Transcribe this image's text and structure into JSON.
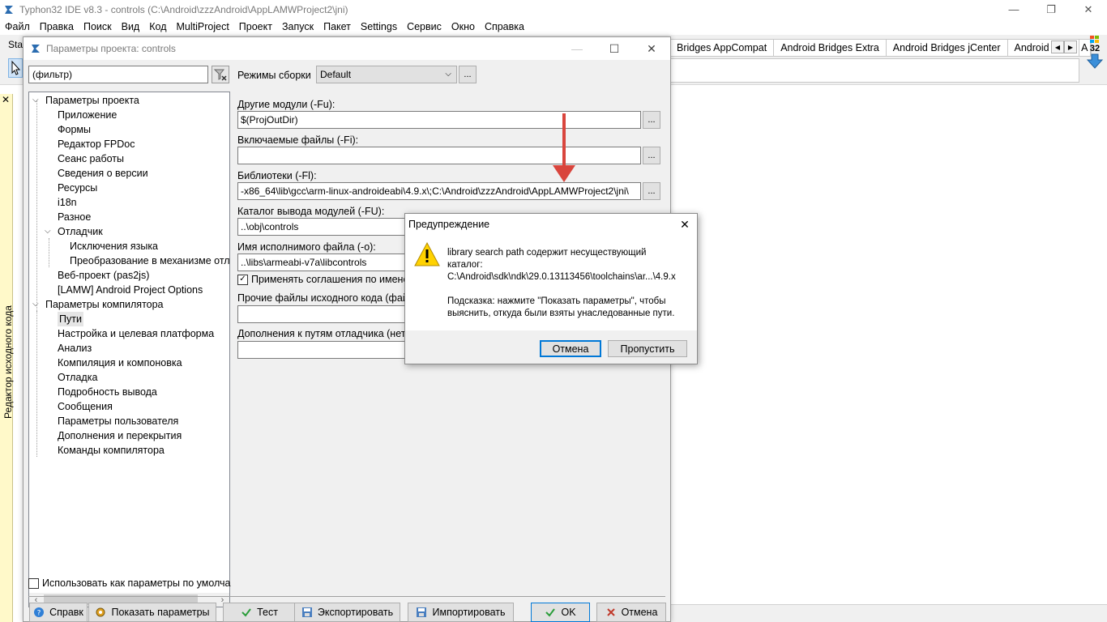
{
  "window": {
    "title": "Typhon32 IDE v8.3 - controls (C:\\Android\\zzzAndroid\\AppLAMWProject2\\jni)",
    "controls": {
      "minimize": "—",
      "restore": "❐",
      "close": "✕"
    }
  },
  "menu": [
    "Файл",
    "Правка",
    "Поиск",
    "Вид",
    "Код",
    "MultiProject",
    "Проект",
    "Запуск",
    "Пакет",
    "Settings",
    "Сервис",
    "Окно",
    "Справка"
  ],
  "toolbar": {
    "left_stub": "Sta",
    "tabs": [
      "Bridges AppCompat",
      "Android Bridges Extra",
      "Android Bridges jCenter",
      "Android FPC",
      "A"
    ],
    "bitness": "32"
  },
  "side_editor": {
    "label": "Редактор исходного кода",
    "close": "✕"
  },
  "dialog": {
    "title": "Параметры проекта: controls",
    "controls": {
      "minimize": "—",
      "maximize": "☐",
      "close": "✕"
    },
    "filter_placeholder": "(фильтр)",
    "tree": [
      {
        "label": "Параметры проекта",
        "level": 0,
        "expanded": true
      },
      {
        "label": "Приложение",
        "level": 1
      },
      {
        "label": "Формы",
        "level": 1
      },
      {
        "label": "Редактор FPDoc",
        "level": 1
      },
      {
        "label": "Сеанс работы",
        "level": 1
      },
      {
        "label": "Сведения о версии",
        "level": 1
      },
      {
        "label": "Ресурсы",
        "level": 1
      },
      {
        "label": "i18n",
        "level": 1
      },
      {
        "label": "Разное",
        "level": 1
      },
      {
        "label": "Отладчик",
        "level": 1,
        "expanded": true
      },
      {
        "label": "Исключения языка",
        "level": 2
      },
      {
        "label": "Преобразование в механизме отлад",
        "level": 2
      },
      {
        "label": "Веб-проект (pas2js)",
        "level": 1
      },
      {
        "label": "[LAMW] Android Project Options",
        "level": 1
      },
      {
        "label": "Параметры компилятора",
        "level": 0,
        "expanded": true
      },
      {
        "label": "Пути",
        "level": 1,
        "selected": true
      },
      {
        "label": "Настройка и целевая платформа",
        "level": 1
      },
      {
        "label": "Анализ",
        "level": 1
      },
      {
        "label": "Компиляция и компоновка",
        "level": 1
      },
      {
        "label": "Отладка",
        "level": 1
      },
      {
        "label": "Подробность вывода",
        "level": 1
      },
      {
        "label": "Сообщения",
        "level": 1
      },
      {
        "label": "Параметры пользователя",
        "level": 1
      },
      {
        "label": "Дополнения и перекрытия",
        "level": 1
      },
      {
        "label": "Команды компилятора",
        "level": 1
      }
    ],
    "use_default_label": "Использовать как параметры по умолча",
    "build_modes_label": "Режимы сборки",
    "build_mode_value": "Default",
    "fields": {
      "other_units_label": "Другие модули (-Fu):",
      "other_units_value": "$(ProjOutDir)",
      "include_label": "Включаемые файлы (-Fi):",
      "include_value": "",
      "libs_label": "Библиотеки (-Fl):",
      "libs_value": "-x86_64\\lib\\gcc\\arm-linux-androideabi\\4.9.x\\;C:\\Android\\zzzAndroid\\AppLAMWProject2\\jni\\",
      "unit_out_label": "Каталог вывода модулей (-FU):",
      "unit_out_value": "..\\obj\\controls",
      "exe_label": "Имя исполнимого файла (-o):",
      "exe_value": "..\\libs\\armeabi-v7a\\libcontrols",
      "naming_label": "Применять соглашения по имено",
      "other_src_label": "Прочие файлы исходного кода (файл",
      "debugger_label": "Дополнения к путям отладчика (нет):",
      "dots": "..."
    },
    "buttons": {
      "help": "Справк",
      "show_options": "Показать параметры",
      "test": "Тест",
      "export": "Экспортировать",
      "import": "Импортировать",
      "ok": "OK",
      "cancel": "Отмена"
    }
  },
  "warning": {
    "title": "Предупреждение",
    "close": "✕",
    "line1": "library search path содержит несуществующий",
    "line2": "каталог:",
    "line3": "C:\\Android\\sdk\\ndk\\29.0.13113456\\toolchains\\ar...\\4.9.x",
    "hint1": "Подсказка: нажмите \"Показать параметры\", чтобы",
    "hint2": "выяснить, откуда были взяты унаследованные пути.",
    "cancel": "Отмена",
    "skip": "Пропустить"
  },
  "colors": {
    "accent": "#0078d7",
    "warning_yellow": "#ffd200",
    "arrow_red": "#d9453d",
    "side_panel": "#fff9c9"
  }
}
